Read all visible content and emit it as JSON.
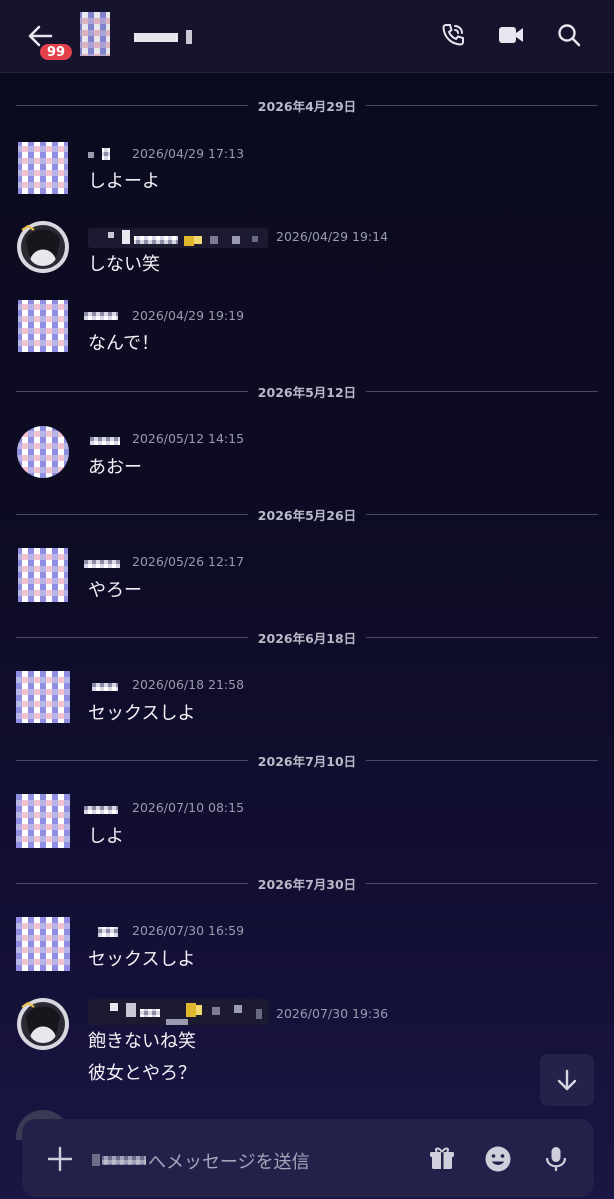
{
  "header": {
    "unread_badge": "99",
    "icons": [
      "back-arrow-icon",
      "phone-call-icon",
      "video-camera-icon",
      "search-icon"
    ]
  },
  "dates": [
    "2026年4月29日",
    "2026年5月12日",
    "2026年5月26日",
    "2026年6月18日",
    "2026年7月10日",
    "2026年7月30日"
  ],
  "messages": [
    {
      "time": "2026/04/29 17:13",
      "text": "しよーよ"
    },
    {
      "time": "2026/04/29 19:14",
      "text": "しない笑"
    },
    {
      "time": "2026/04/29 19:19",
      "text": "なんで！"
    },
    {
      "time": "2026/05/12 14:15",
      "text": "あおー"
    },
    {
      "time": "2026/05/26 12:17",
      "text": "やろー"
    },
    {
      "time": "2026/06/18 21:58",
      "text": "セックスしよ"
    },
    {
      "time": "2026/07/10 08:15",
      "text": "しよ"
    },
    {
      "time": "2026/07/30 16:59",
      "text": "セックスしよ"
    },
    {
      "time": "2026/07/30 19:36",
      "text": "飽きないね笑",
      "text2": "彼女とやろ？"
    }
  ],
  "composer": {
    "placeholder": "へメッセージを送信",
    "icons": [
      "plus-icon",
      "gift-icon",
      "emoji-icon",
      "microphone-icon"
    ]
  },
  "colors": {
    "accent_badge": "#e3414a",
    "background": "#0b0b1f",
    "composer": "#23214a"
  }
}
